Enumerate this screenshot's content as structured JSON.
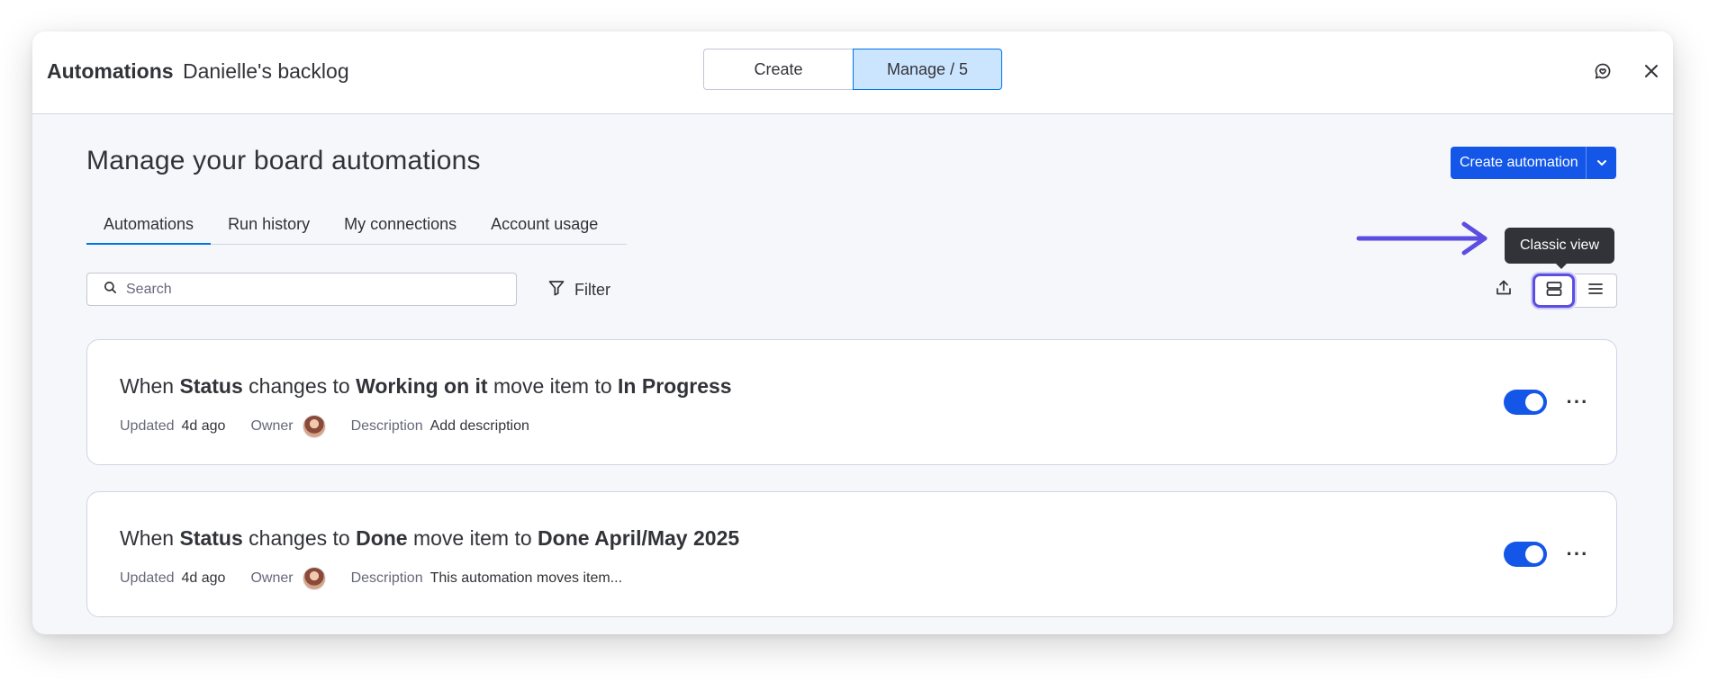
{
  "header": {
    "title_strong": "Automations",
    "title_board": "Danielle's backlog",
    "segments": [
      "Create",
      "Manage / 5"
    ],
    "active_segment": "Manage / 5",
    "feedback_icon": "chat-feedback-icon",
    "close_icon": "close-icon"
  },
  "page": {
    "title": "Manage your board automations",
    "create_button": "Create automation"
  },
  "tabs": [
    "Automations",
    "Run history",
    "My connections",
    "Account usage"
  ],
  "active_tab": "Automations",
  "toolbar": {
    "search_placeholder": "Search",
    "filter_label": "Filter",
    "tooltip": "Classic view"
  },
  "automations": [
    {
      "parts": [
        {
          "t": "When ",
          "b": false
        },
        {
          "t": "Status",
          "b": true
        },
        {
          "t": " changes to ",
          "b": false
        },
        {
          "t": "Working on it",
          "b": true
        },
        {
          "t": " move item to ",
          "b": false
        },
        {
          "t": "In Progress",
          "b": true
        }
      ],
      "updated_label": "Updated",
      "updated_value": "4d ago",
      "owner_label": "Owner",
      "description_label": "Description",
      "description_value": "Add description",
      "enabled": true
    },
    {
      "parts": [
        {
          "t": "When ",
          "b": false
        },
        {
          "t": "Status",
          "b": true
        },
        {
          "t": " changes to ",
          "b": false
        },
        {
          "t": "Done",
          "b": true
        },
        {
          "t": " move item to ",
          "b": false
        },
        {
          "t": "Done April/May 2025",
          "b": true
        }
      ],
      "updated_label": "Updated",
      "updated_value": "4d ago",
      "owner_label": "Owner",
      "description_label": "Description",
      "description_value": "This automation moves item...",
      "enabled": true
    }
  ],
  "colors": {
    "primary": "#1356e8",
    "highlight": "#5b4ee0",
    "tooltip_bg": "#323338"
  }
}
